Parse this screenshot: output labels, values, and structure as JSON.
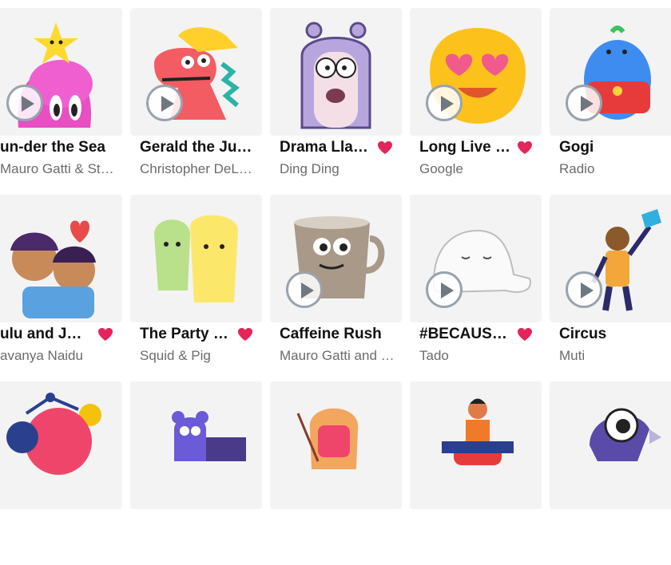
{
  "rows": [
    [
      {
        "title": "un-der the Sea",
        "author": "Mauro Gatti & Stef…",
        "heart": false,
        "play": true,
        "icon": "pink-octopus-star-sticker-icon"
      },
      {
        "title": "Gerald the Jura…",
        "author": "Christopher DeLor…",
        "heart": false,
        "play": true,
        "icon": "red-dinosaur-sticker-icon"
      },
      {
        "title": "Drama Lla…",
        "author": "Ding Ding",
        "heart": true,
        "play": false,
        "icon": "llama-hood-sticker-icon"
      },
      {
        "title": "Long Live t…",
        "author": "Google",
        "heart": true,
        "play": true,
        "icon": "heart-eyes-emoji-icon"
      },
      {
        "title": "Gogi",
        "author": "Radio",
        "heart": false,
        "play": true,
        "icon": "blue-blob-sticker-icon"
      }
    ],
    [
      {
        "title": "ulu and J…",
        "author": "avanya Naidu",
        "heart": true,
        "play": false,
        "icon": "two-kids-sticker-icon"
      },
      {
        "title": "The Party …",
        "author": "Squid & Pig",
        "heart": true,
        "play": false,
        "icon": "hugging-toast-sticker-icon"
      },
      {
        "title": "Caffeine Rush",
        "author": "Mauro Gatti and S…",
        "heart": false,
        "play": true,
        "icon": "coffee-mug-sticker-icon"
      },
      {
        "title": "#BECAUSE…",
        "author": "Tado",
        "heart": true,
        "play": true,
        "icon": "sleeping-seal-sticker-icon"
      },
      {
        "title": "Circus",
        "author": "Muti",
        "heart": false,
        "play": true,
        "icon": "circus-monkey-sticker-icon"
      }
    ],
    [
      {
        "title": "",
        "author": "",
        "heart": false,
        "play": false,
        "icon": "molecule-blob-sticker-icon"
      },
      {
        "title": "",
        "author": "",
        "heart": false,
        "play": false,
        "icon": "purple-creature-sticker-icon"
      },
      {
        "title": "",
        "author": "",
        "heart": false,
        "play": false,
        "icon": "toast-slice-sticker-icon"
      },
      {
        "title": "",
        "author": "",
        "heart": false,
        "play": false,
        "icon": "person-sticker-icon"
      },
      {
        "title": "",
        "author": "",
        "heart": false,
        "play": false,
        "icon": "one-eyed-bird-sticker-icon"
      }
    ]
  ],
  "colors": {
    "heart": "#e5245a",
    "card_bg": "#f3f3f3",
    "title": "#111111",
    "author": "#6b6b6b"
  }
}
